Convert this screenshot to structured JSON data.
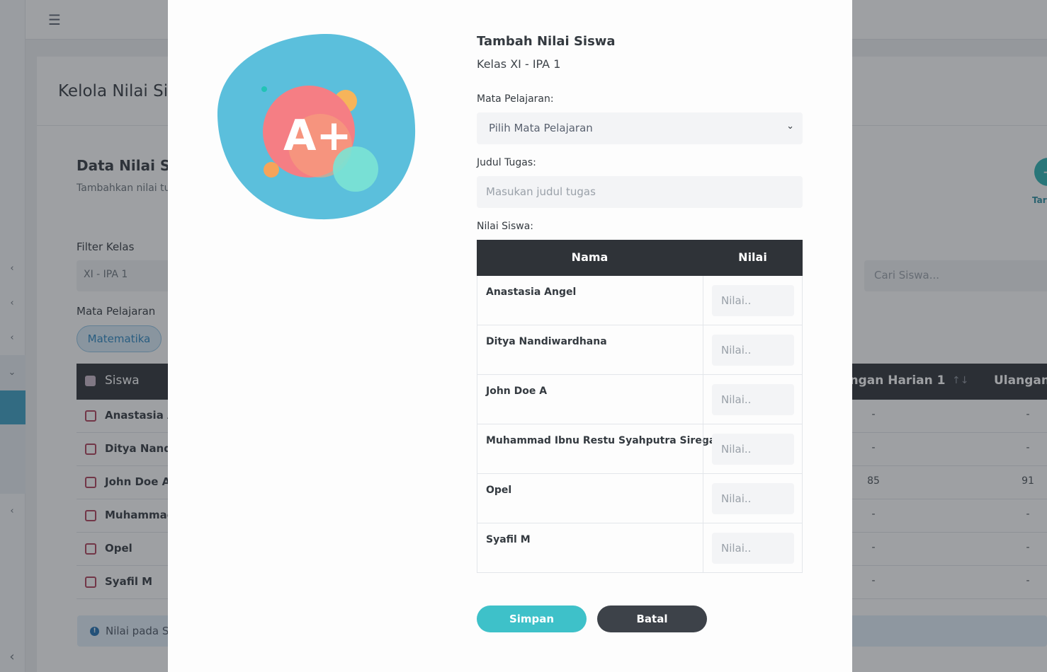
{
  "background": {
    "page_title": "Kelola Nilai Si",
    "section_title": "Data Nilai Si",
    "section_subtitle": "Tambahkan nilai tu",
    "filter_kelas_label": "Filter Kelas",
    "filter_kelas_value": "XI - IPA 1",
    "mapel_label": "Mata Pelajaran",
    "mapel_pill": "Matematika",
    "search_placeholder": "Cari Siswa...",
    "add_button_label": "Tar",
    "table": {
      "col_siswa": "Siswa",
      "col_ulangan1": "angan Harian 1",
      "col_ulangan2": "Ulangan H",
      "sort_icon": "↑↓",
      "rows": [
        {
          "name": "Anastasia A",
          "v1": "-",
          "v2": "-"
        },
        {
          "name": "Ditya Nandi",
          "v1": "-",
          "v2": "-"
        },
        {
          "name": "John Doe A",
          "v1": "85",
          "v2": "91"
        },
        {
          "name": "Muhammad",
          "v1": "-",
          "v2": "-"
        },
        {
          "name": "Opel",
          "v1": "-",
          "v2": "-"
        },
        {
          "name": "Syafil M",
          "v1": "-",
          "v2": "-"
        }
      ]
    },
    "info_text": "Nilai pada Sk"
  },
  "modal": {
    "title": "Tambah Nilai Siswa",
    "subtitle": "Kelas XI - IPA 1",
    "mapel_label": "Mata Pelajaran:",
    "mapel_placeholder": "Pilih Mata Pelajaran",
    "judul_label": "Judul Tugas:",
    "judul_placeholder": "Masukan judul tugas",
    "nilai_label": "Nilai Siswa:",
    "table": {
      "col_nama": "Nama",
      "col_nilai": "Nilai",
      "input_placeholder": "Nilai..",
      "rows": [
        {
          "name": "Anastasia Angel"
        },
        {
          "name": "Ditya Nandiwardhana"
        },
        {
          "name": "John Doe A"
        },
        {
          "name": "Muhammad Ibnu Restu Syahputra Siregar"
        },
        {
          "name": "Opel"
        },
        {
          "name": "Syafil M"
        }
      ]
    },
    "save_label": "Simpan",
    "cancel_label": "Batal",
    "illustration_text": "A+"
  },
  "colors": {
    "accent_teal": "#3ec1c9",
    "dark_header": "#2f3338",
    "blob_blue": "#5bbfdc"
  }
}
